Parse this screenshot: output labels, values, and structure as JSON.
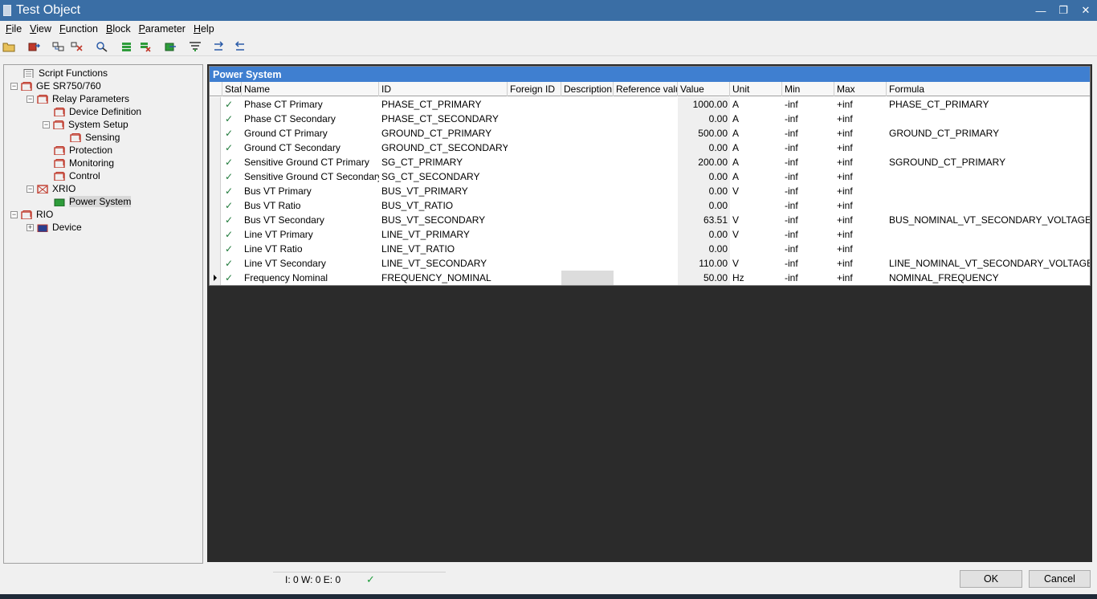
{
  "window": {
    "title": "Test Object",
    "minimize": "—",
    "maximize": "❐",
    "close": "✕"
  },
  "menu": [
    {
      "u": "F",
      "rest": "ile"
    },
    {
      "u": "V",
      "rest": "iew"
    },
    {
      "u": "F",
      "rest": "unction"
    },
    {
      "u": "B",
      "rest": "lock"
    },
    {
      "u": "P",
      "rest": "arameter"
    },
    {
      "u": "H",
      "rest": "elp"
    }
  ],
  "tree": {
    "script_functions": "Script Functions",
    "ge": "GE SR750/760",
    "relay_parameters": "Relay Parameters",
    "device_definition": "Device Definition",
    "system_setup": "System Setup",
    "sensing": "Sensing",
    "protection": "Protection",
    "monitoring": "Monitoring",
    "control": "Control",
    "xrio": "XRIO",
    "power_system": "Power System",
    "rio": "RIO",
    "device": "Device"
  },
  "grid": {
    "title": "Power System",
    "columns": {
      "stat": "Stat",
      "name": "Name",
      "id": "ID",
      "foreign_id": "Foreign ID",
      "description": "Description",
      "reference": "Reference valu",
      "value": "Value",
      "unit": "Unit",
      "min": "Min",
      "max": "Max",
      "formula": "Formula"
    },
    "rows": [
      {
        "stat": "✓",
        "name": "Phase CT Primary",
        "id": "PHASE_CT_PRIMARY",
        "value": "1000.00",
        "unit": "A",
        "min": "-inf",
        "max": "+inf",
        "formula": "PHASE_CT_PRIMARY"
      },
      {
        "stat": "✓",
        "name": "Phase CT Secondary",
        "id": "PHASE_CT_SECONDARY",
        "value": "0.00",
        "unit": "A",
        "min": "-inf",
        "max": "+inf",
        "formula": ""
      },
      {
        "stat": "✓",
        "name": "Ground CT Primary",
        "id": "GROUND_CT_PRIMARY",
        "value": "500.00",
        "unit": "A",
        "min": "-inf",
        "max": "+inf",
        "formula": "GROUND_CT_PRIMARY"
      },
      {
        "stat": "✓",
        "name": "Ground CT Secondary",
        "id": "GROUND_CT_SECONDARY",
        "value": "0.00",
        "unit": "A",
        "min": "-inf",
        "max": "+inf",
        "formula": ""
      },
      {
        "stat": "✓",
        "name": "Sensitive Ground CT Primary",
        "id": "SG_CT_PRIMARY",
        "value": "200.00",
        "unit": "A",
        "min": "-inf",
        "max": "+inf",
        "formula": "SGROUND_CT_PRIMARY"
      },
      {
        "stat": "✓",
        "name": "Sensitive Ground CT Secondary",
        "id": "SG_CT_SECONDARY",
        "value": "0.00",
        "unit": "A",
        "min": "-inf",
        "max": "+inf",
        "formula": ""
      },
      {
        "stat": "✓",
        "name": "Bus VT Primary",
        "id": "BUS_VT_PRIMARY",
        "value": "0.00",
        "unit": "V",
        "min": "-inf",
        "max": "+inf",
        "formula": ""
      },
      {
        "stat": "✓",
        "name": "Bus VT Ratio",
        "id": "BUS_VT_RATIO",
        "value": "0.00",
        "unit": "",
        "min": "-inf",
        "max": "+inf",
        "formula": ""
      },
      {
        "stat": "✓",
        "name": "Bus VT Secondary",
        "id": "BUS_VT_SECONDARY",
        "value": "63.51",
        "unit": "V",
        "min": "-inf",
        "max": "+inf",
        "formula": "BUS_NOMINAL_VT_SECONDARY_VOLTAGE"
      },
      {
        "stat": "✓",
        "name": "Line VT Primary",
        "id": "LINE_VT_PRIMARY",
        "value": "0.00",
        "unit": "V",
        "min": "-inf",
        "max": "+inf",
        "formula": ""
      },
      {
        "stat": "✓",
        "name": "Line VT Ratio",
        "id": "LINE_VT_RATIO",
        "value": "0.00",
        "unit": "",
        "min": "-inf",
        "max": "+inf",
        "formula": ""
      },
      {
        "stat": "✓",
        "name": "Line VT Secondary",
        "id": "LINE_VT_SECONDARY",
        "value": "110.00",
        "unit": "V",
        "min": "-inf",
        "max": "+inf",
        "formula": "LINE_NOMINAL_VT_SECONDARY_VOLTAGE"
      },
      {
        "stat": "✓",
        "name": "Frequency Nominal",
        "id": "FREQUENCY_NOMINAL",
        "value": "50.00",
        "unit": "Hz",
        "min": "-inf",
        "max": "+inf",
        "formula": "NOMINAL_FREQUENCY"
      }
    ]
  },
  "status": {
    "message": "I: 0 W: 0 E: 0",
    "check": "✓"
  },
  "buttons": {
    "ok": "OK",
    "cancel": "Cancel"
  },
  "colors": {
    "title_bar": "#3a6ea5",
    "grid_title": "#3f7fd0",
    "status_ok": "#1e9c3a",
    "tree_icon": "#c0392b",
    "active_icon": "#2e9c3a"
  }
}
